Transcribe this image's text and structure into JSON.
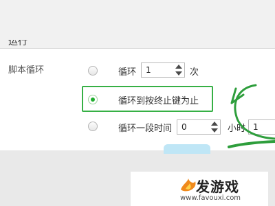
{
  "section": {
    "title": "运行"
  },
  "loop": {
    "label": "脚本循环",
    "options": [
      {
        "label": "循环",
        "value": "1",
        "unit": "次",
        "selected": false
      },
      {
        "label": "循环到按终止键为止",
        "selected": true
      },
      {
        "label": "循环一段时间",
        "value": "0",
        "unit": "小时",
        "value2": "1",
        "selected": false
      }
    ]
  },
  "watermark": {
    "brand": "发游戏",
    "url": "www.favouxi.com",
    "icon": "flame-logo"
  },
  "colors": {
    "highlight": "#36b045",
    "annotation_arrow": "#2e9e3c",
    "radio_selected": "#1fae2e"
  }
}
